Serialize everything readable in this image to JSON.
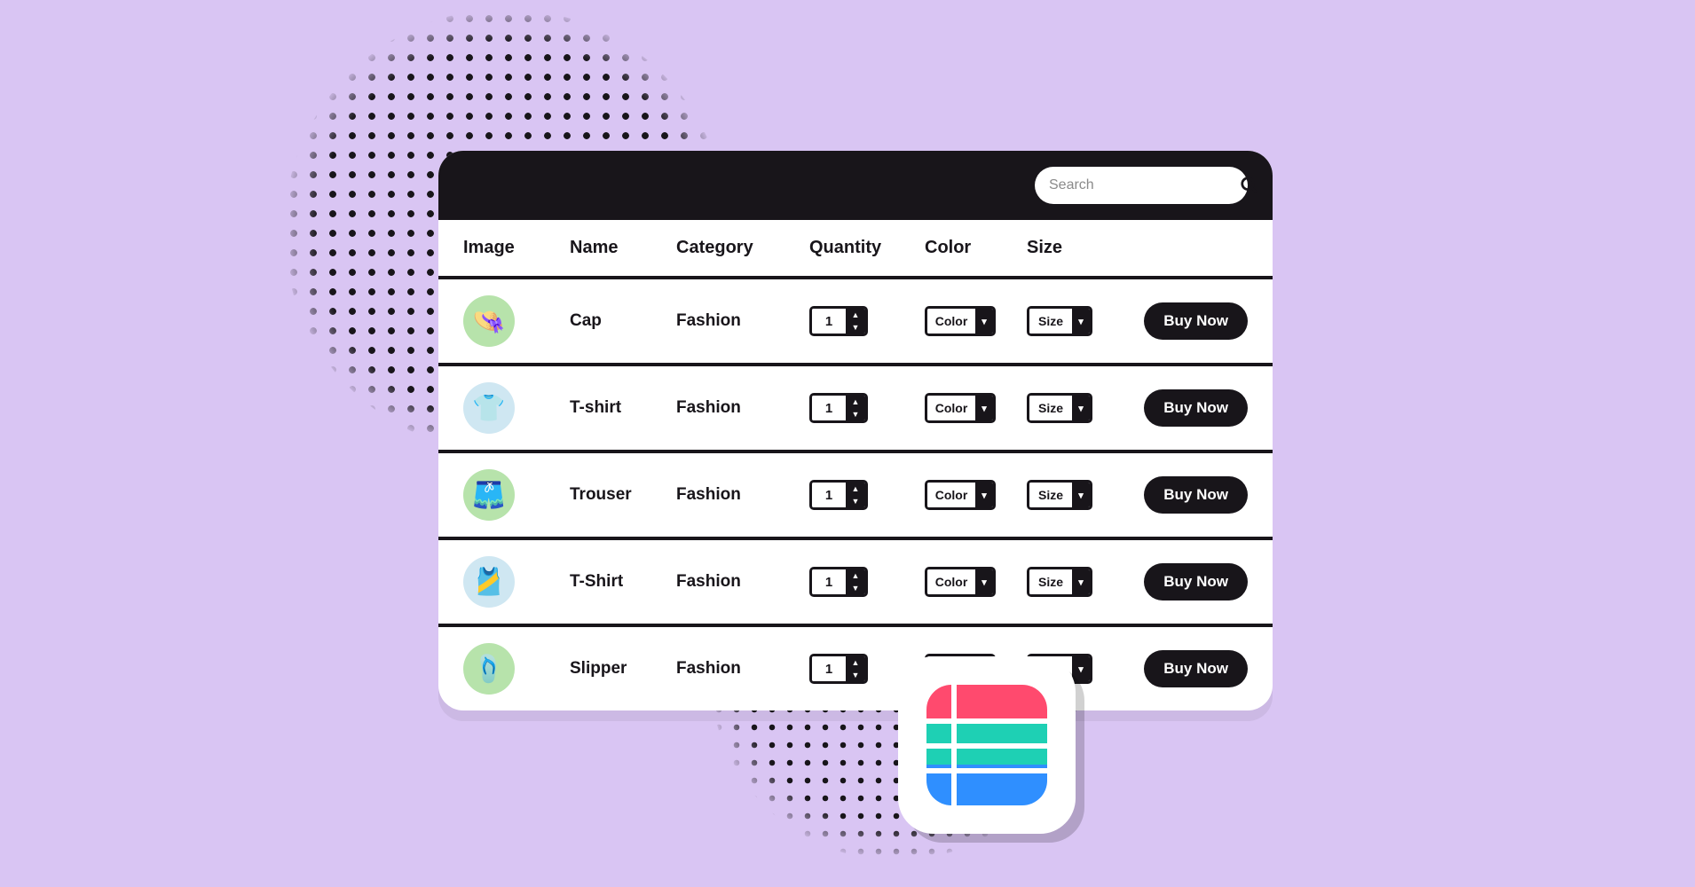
{
  "search": {
    "placeholder": "Search"
  },
  "columns": [
    "Image",
    "Name",
    "Category",
    "Quantity",
    "Color",
    "Size"
  ],
  "defaults": {
    "quantity": "1",
    "color_label": "Color",
    "size_label": "Size",
    "buy_label": "Buy Now"
  },
  "rows": [
    {
      "name": "Cap",
      "category": "Fashion",
      "icon_bg": "#b7e3ab",
      "emoji": "👒"
    },
    {
      "name": "T-shirt",
      "category": "Fashion",
      "icon_bg": "#cfe7f2",
      "emoji": "👕"
    },
    {
      "name": "Trouser",
      "category": "Fashion",
      "icon_bg": "#b7e3ab",
      "emoji": "🩳"
    },
    {
      "name": "T-Shirt",
      "category": "Fashion",
      "icon_bg": "#cfe7f2",
      "emoji": "🎽"
    },
    {
      "name": "Slipper",
      "category": "Fashion",
      "icon_bg": "#b7e3ab",
      "emoji": "🩴"
    }
  ]
}
